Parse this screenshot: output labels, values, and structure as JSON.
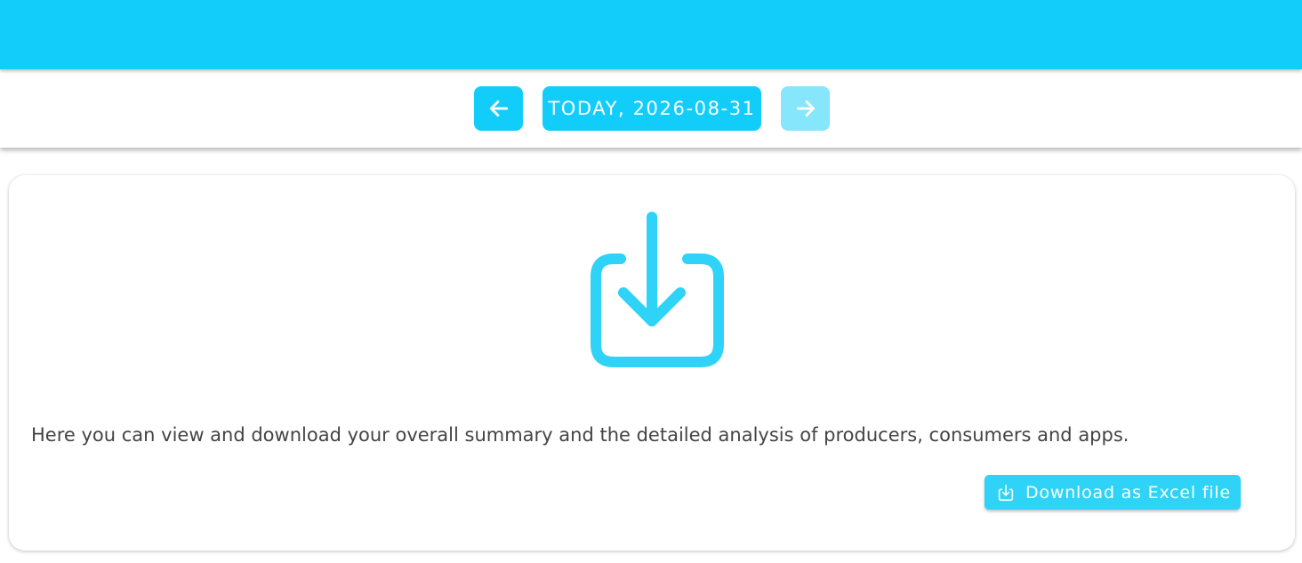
{
  "date_nav": {
    "today_label": "TODAY, 2026-08-31",
    "prev_icon": "arrow-left-icon",
    "next_icon": "arrow-right-icon",
    "next_disabled": true
  },
  "card": {
    "icon": "download-into-box-icon",
    "description": "Here you can view and download your overall summary and the detailed analysis of producers, consumers and apps.",
    "download_label": "Download as Excel file",
    "download_icon": "download-into-box-icon"
  },
  "colors": {
    "accent": "#12cdfa",
    "icon": "#2fd3f7",
    "disabled": "#86e6fb",
    "text": "#444444"
  }
}
